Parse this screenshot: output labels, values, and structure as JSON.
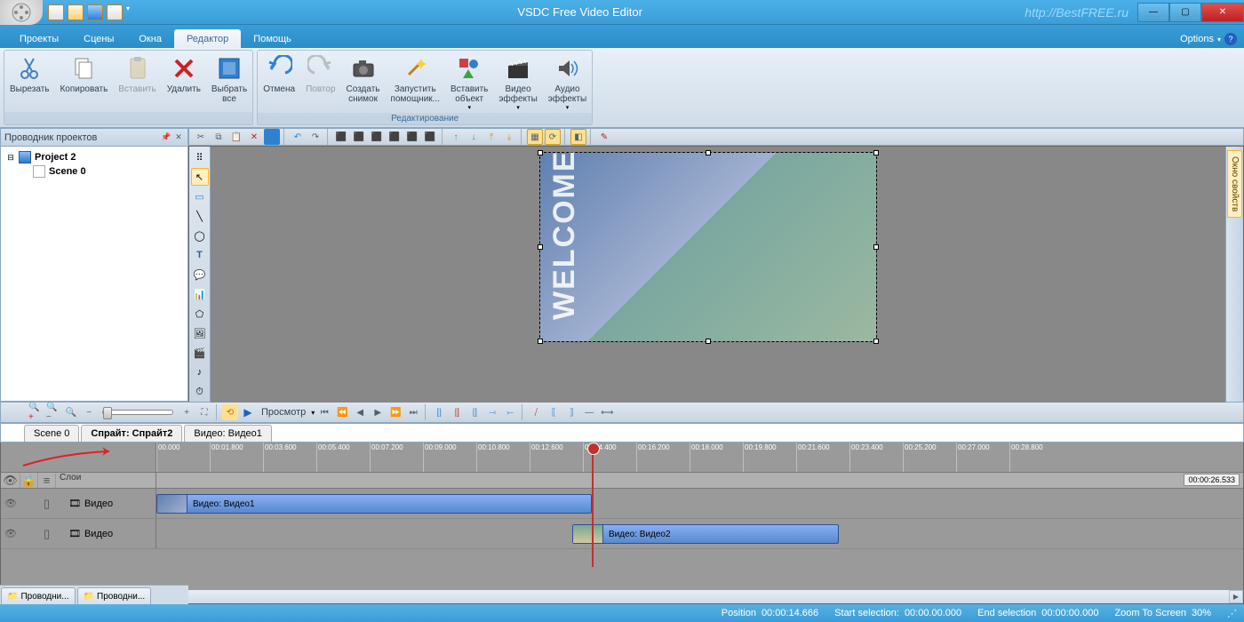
{
  "title": "VSDC Free Video Editor",
  "watermark": "http://BestFREE.ru",
  "menus": {
    "options": "Options"
  },
  "tabs": [
    "Проекты",
    "Сцены",
    "Окна",
    "Редактор",
    "Помощь"
  ],
  "active_tab": 3,
  "ribbon": {
    "group1_label": "",
    "group2_label": "Редактирование",
    "cut": "Вырезать",
    "copy": "Копировать",
    "paste": "Вставить",
    "delete": "Удалить",
    "select_all": "Выбрать\nвсе",
    "undo": "Отмена",
    "redo": "Повтор",
    "snapshot": "Создать\nснимок",
    "wizard": "Запустить\nпомощник...",
    "insert_obj": "Вставить\nобъект",
    "video_fx": "Видео\nэффекты",
    "audio_fx": "Аудио\nэффекты"
  },
  "explorer": {
    "title": "Проводник проектов",
    "root": "Project 2",
    "scene": "Scene 0",
    "tab1": "Проводни...",
    "tab2": "Проводни..."
  },
  "preview_overlay": "WELCOME",
  "side_panel": {
    "props": "Окно свойств"
  },
  "preview_toolbar": {
    "preview": "Просмотр"
  },
  "timeline": {
    "tabs": [
      "Scene 0",
      "Спрайт: Спрайт2",
      "Видео: Видео1"
    ],
    "active_tab": 1,
    "layers_label": "Слои",
    "track1_name": "Видео",
    "track2_name": "Видео",
    "clip1": "Видео: Видео1",
    "clip2": "Видео: Видео2",
    "zoom_box": "00:00:26.533",
    "ruler": [
      "00.000",
      "00:01.800",
      "00:03.600",
      "00:05.400",
      "00:07.200",
      "00:09.000",
      "00:10.800",
      "00:12.600",
      "00:14.400",
      "00:16.200",
      "00:18.000",
      "00:19.800",
      "00:21.600",
      "00:23.400",
      "00:25.200",
      "00:27.000",
      "00:28.800"
    ]
  },
  "status": {
    "position_l": "Position",
    "position": "00:00:14.666",
    "start_l": "Start selection:",
    "start": "00:00.00.000",
    "end_l": "End selection",
    "end": "00:00:00.000",
    "zoom_l": "Zoom To Screen",
    "zoom": "30%"
  }
}
